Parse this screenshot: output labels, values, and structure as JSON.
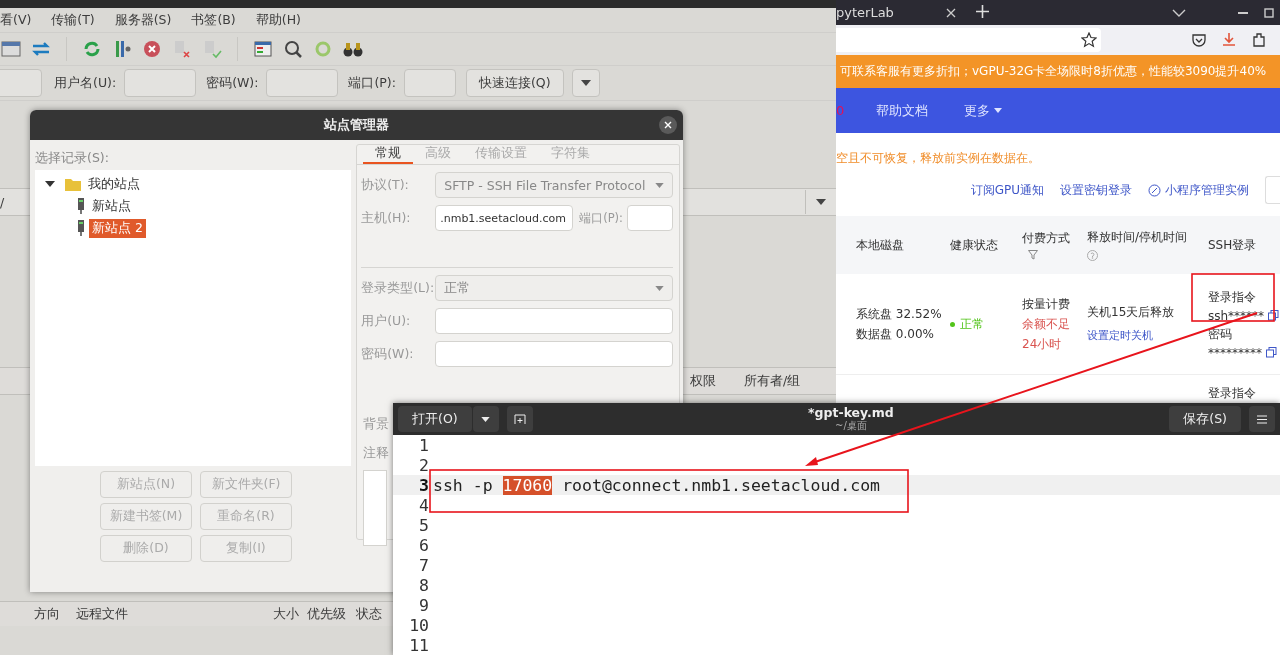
{
  "filezilla": {
    "menu": [
      "看(V)",
      "传输(T)",
      "服务器(S)",
      "书签(B)",
      "帮助(H)"
    ],
    "quickconnect": {
      "fields": [
        {
          "label": "用户名(U):"
        },
        {
          "label": "密码(W):"
        },
        {
          "label": "端口(P):"
        }
      ],
      "button": "快速连接(Q)"
    },
    "remote_path": "/",
    "file_columns": [
      "权限",
      "所有者/组"
    ],
    "queue_columns": [
      "方向",
      "远程文件",
      "大小",
      "优先级",
      "状态"
    ]
  },
  "site_manager": {
    "title": "站点管理器",
    "tree_label": "选择记录(S):",
    "tree": [
      {
        "label": "我的站点",
        "expanded": true,
        "children": [
          {
            "label": "新站点",
            "selected": false
          },
          {
            "label": "新站点 2",
            "selected": true
          }
        ]
      }
    ],
    "buttons": [
      "新站点(N)",
      "新文件夹(F)",
      "新建书签(M)",
      "重命名(R)",
      "删除(D)",
      "复制(I)"
    ],
    "tabs": [
      {
        "label": "常规",
        "selected": true
      },
      {
        "label": "高级",
        "selected": false
      },
      {
        "label": "传输设置",
        "selected": false
      },
      {
        "label": "字符集",
        "selected": false
      }
    ],
    "protocol": {
      "label": "协议(T):",
      "value": "SFTP - SSH File Transfer Protocol"
    },
    "host": {
      "label": "主机(H):",
      "value": ".nmb1.seetacloud.com"
    },
    "port": {
      "label": "端口(P):"
    },
    "logon_type": {
      "label": "登录类型(L):",
      "value": "正常"
    },
    "user": {
      "label": "用户(U):"
    },
    "password": {
      "label": "密码(W):"
    },
    "background_label": "背景",
    "comments_label": "注释"
  },
  "browser": {
    "tab": "pyterLab",
    "banner": "可联系客服有更多折扣；vGPU-32G卡全场限时8折优惠，性能较3090提升40%",
    "nav": [
      {
        "label": "0",
        "kind": "badge"
      },
      {
        "label": "帮助文档",
        "kind": "link"
      },
      {
        "label": "更多",
        "kind": "menu"
      }
    ],
    "notice": "空且不可恢复，释放前实例在数据在。",
    "actions": [
      "订阅GPU通知",
      "设置密钥登录",
      "小程序管理实例"
    ],
    "table": {
      "columns": [
        "本地磁盘",
        "健康状态",
        "付费方式",
        "释放时间/停机时间",
        "SSH登录"
      ],
      "row": {
        "disk": [
          "系统盘 32.52%",
          "数据盘 0.00%"
        ],
        "health": {
          "text": "正常",
          "color": "#52c41a"
        },
        "billing": "按量计费",
        "warning": [
          "余额不足",
          "24小时"
        ],
        "release": "关机15天后释放",
        "release_link": "设置定时关机",
        "ssh_label": "登录指令",
        "ssh_value": "ssh******",
        "password_label": "密码",
        "password_value": "*********"
      },
      "next_row": {
        "ssh_label": "登录指令"
      }
    }
  },
  "editor": {
    "open": "打开(O)",
    "title": "*gpt-key.md",
    "subtitle": "~/桌面",
    "save": "保存(S)",
    "lines": [
      {
        "number": "1",
        "current": false
      },
      {
        "number": "2",
        "current": false
      },
      {
        "number": "3",
        "current": true,
        "segments": [
          {
            "text": "ssh -p ",
            "selected": false
          },
          {
            "text": "17060",
            "selected": true
          },
          {
            "text": " root@connect.nmb1.seetacloud.com",
            "selected": false
          }
        ]
      },
      {
        "number": "4",
        "current": false
      },
      {
        "number": "5",
        "current": false
      },
      {
        "number": "6",
        "current": false
      },
      {
        "number": "7",
        "current": false
      },
      {
        "number": "8",
        "current": false
      },
      {
        "number": "9",
        "current": false
      },
      {
        "number": "10",
        "current": false
      },
      {
        "number": "11",
        "current": false
      }
    ]
  }
}
